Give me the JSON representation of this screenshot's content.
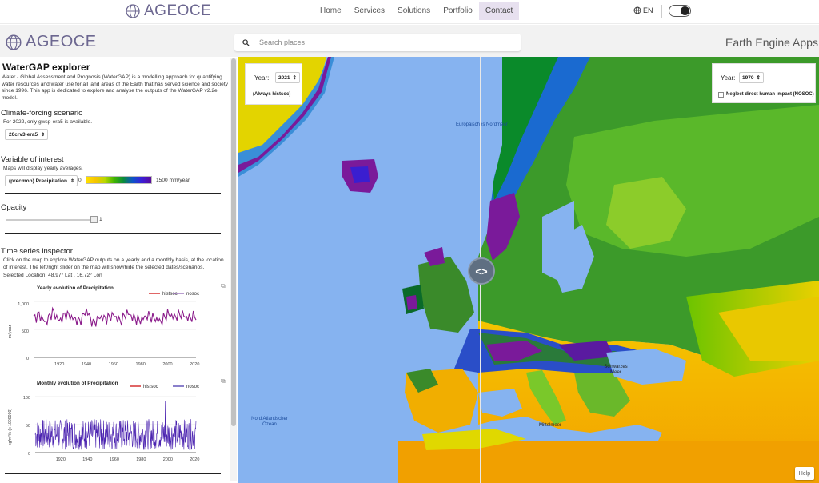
{
  "topnav": {
    "logo_text": "AGEOCE",
    "menu": [
      {
        "label": "Home",
        "active": false
      },
      {
        "label": "Services",
        "active": false
      },
      {
        "label": "Solutions",
        "active": false
      },
      {
        "label": "Portfolio",
        "active": false
      },
      {
        "label": "Contact",
        "active": true
      }
    ],
    "lang": "EN"
  },
  "apphead": {
    "logo_text": "AGEOCE",
    "search_placeholder": "Search places",
    "right_title": "Earth Engine Apps"
  },
  "sidebar": {
    "title": "WaterGAP explorer",
    "description": "Water - Global Assessment and Prognosis (WaterGAP) is a modelling approach for quantifying water resources and water use for all land areas of the Earth that has served science and society since 1996. This app is dedicated to explore and analyse the outputs of the WaterGAP v2.2e model.",
    "climate": {
      "title": "Climate-forcing scenario",
      "note": "For 2022, only gwsp-era5 is available.",
      "selected": "20crv3-era5"
    },
    "variable": {
      "title": "Variable of interest",
      "note": "Maps will display yearly averages.",
      "selected": "(precmon) Precipitation",
      "legend_min": "0",
      "legend_max": "1500 mm/year"
    },
    "opacity": {
      "title": "Opacity",
      "value": "1"
    },
    "timeseries": {
      "title": "Time series inspector",
      "description": "Click on the map to explore WaterGAP outputs on a yearly and a monthly basis, at the location of interest. The left/right slider on the map will show/hide the selected dates/scenarios.",
      "location": "Selected Location: 48.97° Lat , 16.72° Lon"
    }
  },
  "charts": {
    "yearly": {
      "title": "Yearly evolution of Precipitation",
      "ylabel": "m/year",
      "legend": [
        "histsoc",
        "nosoc"
      ],
      "yticks": [
        "1,000",
        "500",
        "0"
      ],
      "xticks": [
        "1920",
        "1940",
        "1960",
        "1980",
        "2000",
        "2020"
      ]
    },
    "monthly": {
      "title": "Monthly evolution of Precipitation",
      "ylabel": "kg/m²/s (x 1000000)",
      "legend": [
        "histsoc",
        "nosoc"
      ],
      "yticks": [
        "100",
        "50",
        "0"
      ],
      "xticks": [
        "1920",
        "1940",
        "1960",
        "1980",
        "2000",
        "2020"
      ]
    }
  },
  "chart_data": [
    {
      "type": "line",
      "title": "Yearly evolution of Precipitation",
      "ylabel": "m/year",
      "xlim": [
        1901,
        2021
      ],
      "ylim": [
        0,
        1000
      ],
      "series": [
        {
          "name": "histsoc",
          "color": "#cc0000"
        },
        {
          "name": "nosoc",
          "color": "#8a5bb0"
        }
      ],
      "x": [
        1901,
        1905,
        1910,
        1915,
        1920,
        1925,
        1930,
        1935,
        1940,
        1945,
        1950,
        1955,
        1960,
        1965,
        1970,
        1975,
        1980,
        1985,
        1990,
        1995,
        2000,
        2005,
        2010,
        2015,
        2021
      ],
      "values": [
        700,
        760,
        620,
        820,
        650,
        780,
        700,
        640,
        840,
        600,
        720,
        690,
        760,
        640,
        800,
        700,
        660,
        750,
        700,
        640,
        780,
        720,
        780,
        700,
        740
      ]
    },
    {
      "type": "line",
      "title": "Monthly evolution of Precipitation",
      "ylabel": "kg/m²/s (x 1000000)",
      "xlim": [
        1901,
        2021
      ],
      "ylim": [
        0,
        100
      ],
      "series": [
        {
          "name": "histsoc",
          "color": "#cc0000"
        },
        {
          "name": "nosoc",
          "color": "#3b2aa8"
        }
      ],
      "range_low": 5,
      "range_high": 60,
      "peak": {
        "x": 1998,
        "y": 92
      }
    }
  ],
  "map": {
    "left_panel": {
      "year_label": "Year:",
      "year": "2021",
      "note": "(Always histsoc)"
    },
    "right_panel": {
      "year_label": "Year:",
      "year": "1970",
      "checkbox_label": "Neglect direct human impact (NOSOC)",
      "checked": false
    },
    "labels": {
      "north_sea": "Europäisches Nordmeer",
      "atlantic": "Nord Atlantischer Ozean",
      "black_sea": "Schwarzes Meer",
      "mediterranean": "Mittelmeer"
    },
    "help": "Help"
  },
  "colors": {
    "accent": "#e7e0ef",
    "logo": "#6c6790",
    "ocean": "#86b3f0"
  }
}
